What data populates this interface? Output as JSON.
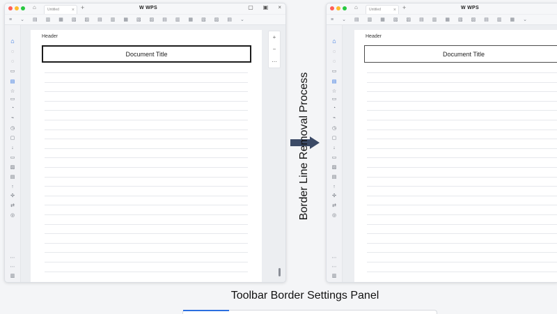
{
  "brand": {
    "accent": "#2b6fe0"
  },
  "left_window": {
    "tab_label": "Untitled",
    "logo": "W WPS",
    "header_label": "Header",
    "document_title": "Document Title",
    "zoom": {
      "plus": "+",
      "minus": "−",
      "more": "⋯"
    }
  },
  "right_window": {
    "tab_label": "Untitled",
    "logo": "W WPS",
    "header_label": "Header",
    "document_title": "Document Title"
  },
  "process_label": "Border Line Removal Process",
  "caption": "Toolbar Border Settings Panel"
}
